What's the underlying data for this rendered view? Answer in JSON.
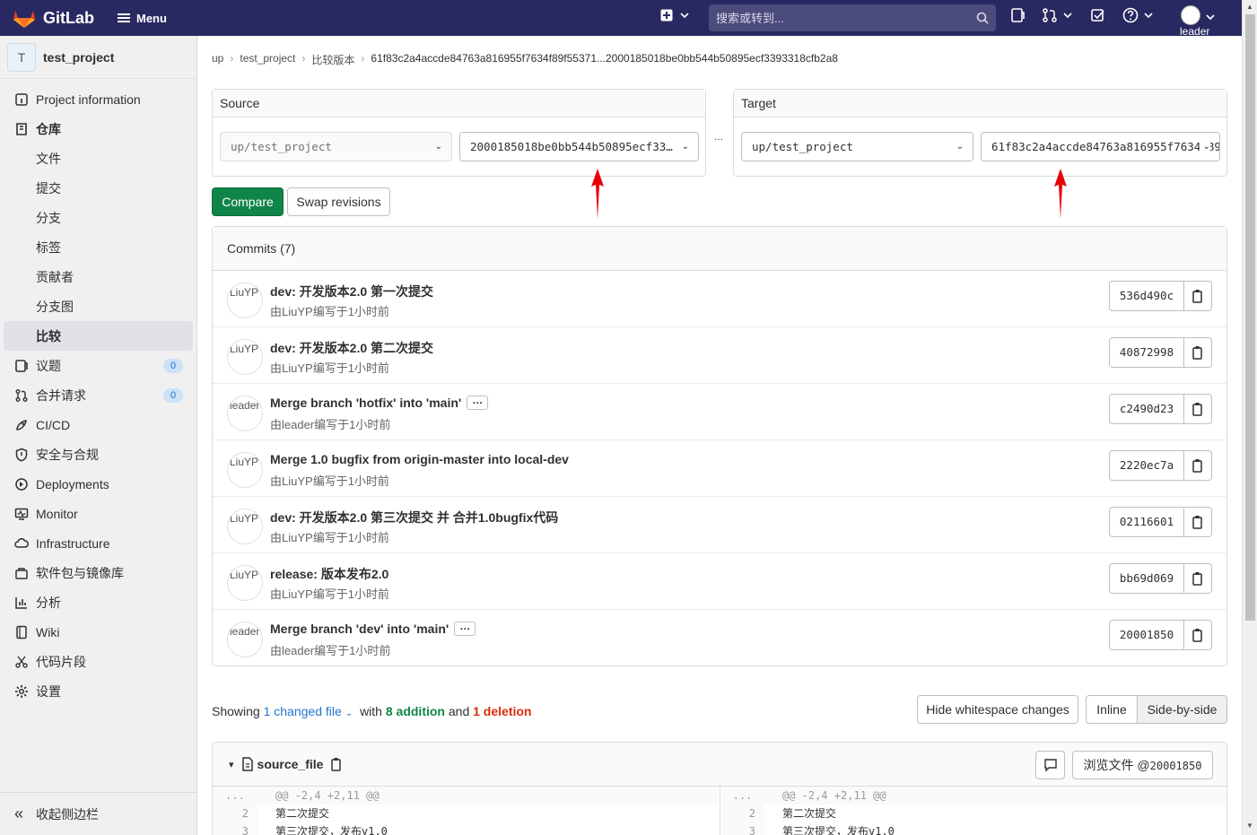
{
  "topbar": {
    "brand": "GitLab",
    "menu_label": "Menu",
    "search_placeholder": "搜索或转到...",
    "user_label": "leader"
  },
  "sidebar": {
    "project_initial": "T",
    "project_name": "test_project",
    "items": [
      {
        "label": "Project information",
        "icon": "info-icon"
      },
      {
        "label": "仓库",
        "icon": "repository-icon"
      },
      {
        "label": "文件"
      },
      {
        "label": "提交"
      },
      {
        "label": "分支"
      },
      {
        "label": "标签"
      },
      {
        "label": "贡献者"
      },
      {
        "label": "分支图"
      },
      {
        "label": "比较"
      },
      {
        "label": "议题",
        "icon": "issues-icon",
        "badge": "0"
      },
      {
        "label": "合并请求",
        "icon": "merge-request-icon",
        "badge": "0"
      },
      {
        "label": "CI/CD",
        "icon": "rocket-icon"
      },
      {
        "label": "安全与合规",
        "icon": "shield-icon"
      },
      {
        "label": "Deployments",
        "icon": "deployments-icon"
      },
      {
        "label": "Monitor",
        "icon": "monitor-icon"
      },
      {
        "label": "Infrastructure",
        "icon": "cloud-icon"
      },
      {
        "label": "软件包与镜像库",
        "icon": "package-icon"
      },
      {
        "label": "分析",
        "icon": "chart-icon"
      },
      {
        "label": "Wiki",
        "icon": "book-icon"
      },
      {
        "label": "代码片段",
        "icon": "snippet-icon"
      },
      {
        "label": "设置",
        "icon": "gear-icon"
      }
    ],
    "collapse_label": "收起侧边栏"
  },
  "breadcrumb": [
    "up",
    "test_project",
    "比较版本",
    "61f83c2a4accde84763a816955f7634f89f55371...2000185018be0bb544b50895ecf3393318cfb2a8"
  ],
  "source": {
    "title": "Source",
    "project": "up/test_project",
    "revision": "2000185018be0bb544b50895ecf3393318cfb2a8"
  },
  "target": {
    "title": "Target",
    "project": "up/test_project",
    "revision": "61f83c2a4accde84763a816955f7634f89f55371"
  },
  "separator": "...",
  "buttons": {
    "compare": "Compare",
    "swap": "Swap revisions"
  },
  "commits": {
    "header": "Commits (7)",
    "rows": [
      {
        "avatar_alt": "LiuYP's",
        "title": "dev: 开发版本2.0 第一次提交",
        "meta": "由LiuYP编写于1小时前",
        "sha": "536d490c",
        "ellipsis": false
      },
      {
        "avatar_alt": "LiuYP's",
        "title": "dev: 开发版本2.0 第二次提交",
        "meta": "由LiuYP编写于1小时前",
        "sha": "40872998",
        "ellipsis": false
      },
      {
        "avatar_alt": "leader's",
        "title": "Merge branch 'hotfix' into 'main'",
        "meta": "由leader编写于1小时前",
        "sha": "c2490d23",
        "ellipsis": true
      },
      {
        "avatar_alt": "LiuYP's",
        "title": "Merge 1.0 bugfix from origin-master into local-dev",
        "meta": "由LiuYP编写于1小时前",
        "sha": "2220ec7a",
        "ellipsis": false
      },
      {
        "avatar_alt": "LiuYP's",
        "title": "dev: 开发版本2.0 第三次提交 并 合并1.0bugfix代码",
        "meta": "由LiuYP编写于1小时前",
        "sha": "02116601",
        "ellipsis": false
      },
      {
        "avatar_alt": "LiuYP's",
        "title": "release: 版本发布2.0",
        "meta": "由LiuYP编写于1小时前",
        "sha": "bb69d069",
        "ellipsis": false
      },
      {
        "avatar_alt": "leader's",
        "title": "Merge branch 'dev' into 'main'",
        "meta": "由leader编写于1小时前",
        "sha": "20001850",
        "ellipsis": true
      }
    ]
  },
  "summary": {
    "showing": "Showing",
    "changed": "1 changed file",
    "with": "with",
    "additions": "8 addition",
    "and": "and",
    "deletions": "1 deletion"
  },
  "view_buttons": {
    "whitespace": "Hide whitespace changes",
    "inline": "Inline",
    "side_by_side": "Side-by-side"
  },
  "file": {
    "name": "source_file",
    "view_file_label": "浏览文件 @",
    "view_file_sha": "20001850",
    "hunk": "@@ -2,4 +2,11 @@",
    "expand": "...",
    "lines": [
      {
        "num": "2",
        "text": "第二次提交"
      },
      {
        "num": "3",
        "text": "第三次提交，发布v1.0"
      }
    ]
  },
  "colors": {
    "topbar": "#292961",
    "primary": "#108548",
    "link": "#1f75cb",
    "deletion": "#dd2b0e",
    "annotation_arrow": "#e8000b"
  }
}
